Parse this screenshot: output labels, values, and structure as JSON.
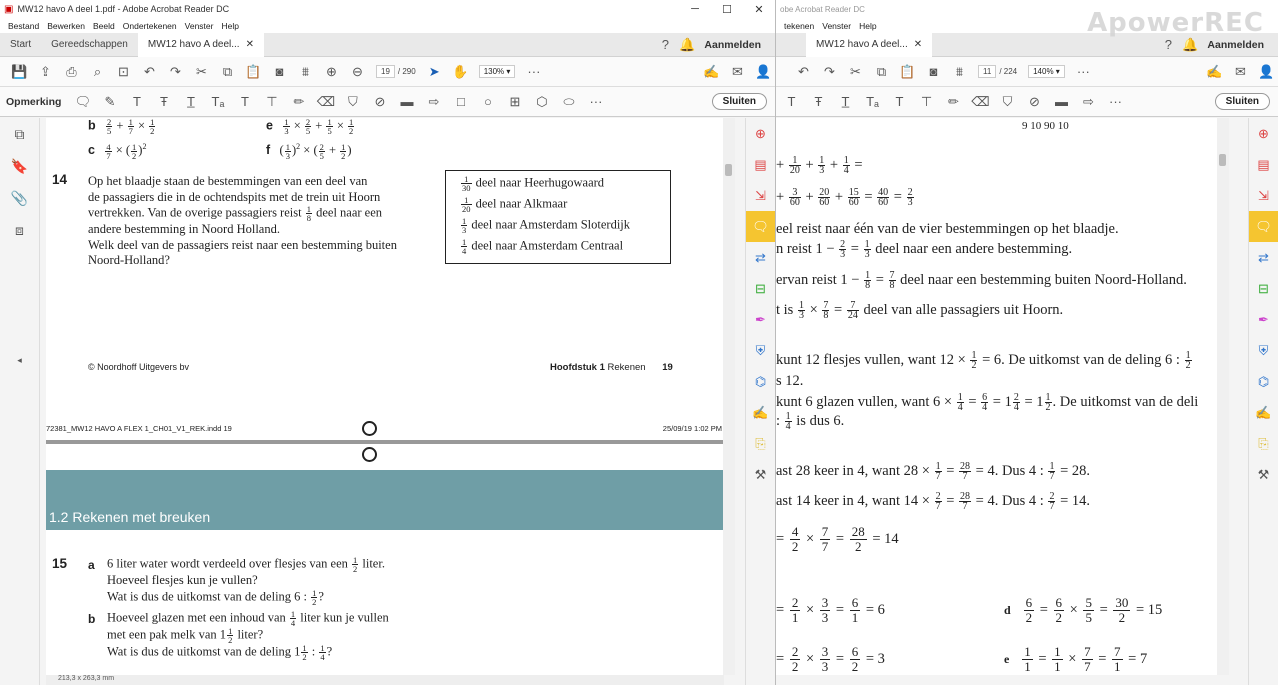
{
  "left": {
    "window_title": "MW12 havo A deel 1.pdf - Adobe Acrobat Reader DC",
    "menu": [
      "Bestand",
      "Bewerken",
      "Beeld",
      "Ondertekenen",
      "Venster",
      "Help"
    ],
    "tabs": {
      "start": "Start",
      "tools": "Gereedschappen",
      "doc": "MW12 havo A deel..."
    },
    "signin": "Aanmelden",
    "page_current": "19",
    "page_total": "/ 290",
    "zoom": "130%",
    "comment_label": "Opmerking",
    "close_label": "Sluiten",
    "status": "213,3 x 263,3 mm"
  },
  "right": {
    "window_title": "obe Acrobat Reader DC",
    "menu": [
      "tekenen",
      "Venster",
      "Help"
    ],
    "tabs": {
      "doc": "MW12 havo A deel..."
    },
    "signin": "Aanmelden",
    "page_current": "11",
    "page_total": "/ 224",
    "zoom": "140%",
    "close_label": "Sluiten"
  },
  "page": {
    "prev_b": "b",
    "prev_c": "c",
    "prev_e": "e",
    "prev_f": "f",
    "q14_num": "14",
    "q14_line1": "Op het blaadje staan de bestemmingen van een deel van",
    "q14_line2": "de passagiers die in de ochtendspits met de trein uit Hoorn",
    "q14_line3a": "vertrekken. Van de overige passagiers reist",
    "q14_line3b": "deel naar een",
    "q14_line4": "andere bestemming in Noord Holland.",
    "q14_line5": "Welk deel van de passagiers reist naar een bestemming buiten",
    "q14_line6": "Noord-Holland?",
    "box_items": [
      {
        "n": "1",
        "d": "30",
        "label": "deel naar Heerhugowaard"
      },
      {
        "n": "1",
        "d": "20",
        "label": "deel naar Alkmaar"
      },
      {
        "n": "1",
        "d": "3",
        "label": "deel naar Amsterdam Sloterdijk"
      },
      {
        "n": "1",
        "d": "4",
        "label": "deel naar Amsterdam Centraal"
      }
    ],
    "publisher": "© Noordhoff Uitgevers bv",
    "chapter_bold": "Hoofdstuk 1",
    "chapter_rest": "Rekenen",
    "page_no": "19",
    "slug_left": "72381_MW12 HAVO A FLEX 1_CH01_V1_REK.indd 19",
    "slug_right": "25/09/19 1:02 PM",
    "section_title": "1.2    Rekenen met breuken",
    "q15_num": "15",
    "q15a_label": "a",
    "q15a_l1a": "6 liter water wordt verdeeld over flesjes van een",
    "q15a_l1b": "liter.",
    "q15a_l2": "Hoeveel flesjes kun je vullen?",
    "q15a_l3a": "Wat is dus de uitkomst van de deling 6 :",
    "q15a_l3b": "?",
    "q15b_label": "b",
    "q15b_l1a": "Hoeveel glazen met een inhoud van",
    "q15b_l1b": "liter kun je vullen",
    "q15b_l2a": "met een pak melk van 1",
    "q15b_l2b": "liter?",
    "q15b_l3a": "Wat is dus de uitkomst van de deling 1",
    "q15b_l3b": ":",
    "q15b_l3c": "?"
  },
  "answers": {
    "top_nums": "9   10   90   10",
    "l_eq": "=",
    "l_sum": "40",
    "l_sum_d": "60",
    "l_res": "2",
    "l_res_d": "3",
    "l_deel": "eel reist naar één van de vier bestemmingen op het blaadje.",
    "l_reist1": "n reist 1 −",
    "l_reist1b": "deel naar een andere bestemming.",
    "l_ervan": "ervan reist 1 −",
    "l_ervanb": "deel naar een bestemming buiten Noord-Holland.",
    "l_tis": "t is",
    "l_tisb": "deel van alle passagiers uit Hoorn.",
    "l_kunt12": "kunt 12 flesjes vullen, want 12 ×",
    "l_kunt12b": "= 6. De uitkomst van de deling 6 :",
    "l_s12": "s 12.",
    "l_kunt6": "kunt 6 glazen vullen, want 6 ×",
    "l_kunt6b": ". De uitkomst van de deli",
    "l_isdus6": "is dus 6.",
    "l_ast28": "ast 28 keer in 4, want 28 ×",
    "l_ast28b": "= 4. Dus 4 :",
    "l_ast28c": "= 28.",
    "l_ast14": "ast 14 keer in 4, want 14 ×",
    "l_ast14b": "= 4. Dus 4 :",
    "l_ast14c": "= 14.",
    "l_14": "= 14",
    "l_6": "= 6",
    "l_15": "= 15",
    "l_3": "= 3",
    "l_7": "= 7",
    "label_d": "d",
    "label_e": "e"
  },
  "watermark": "ApowerREC"
}
